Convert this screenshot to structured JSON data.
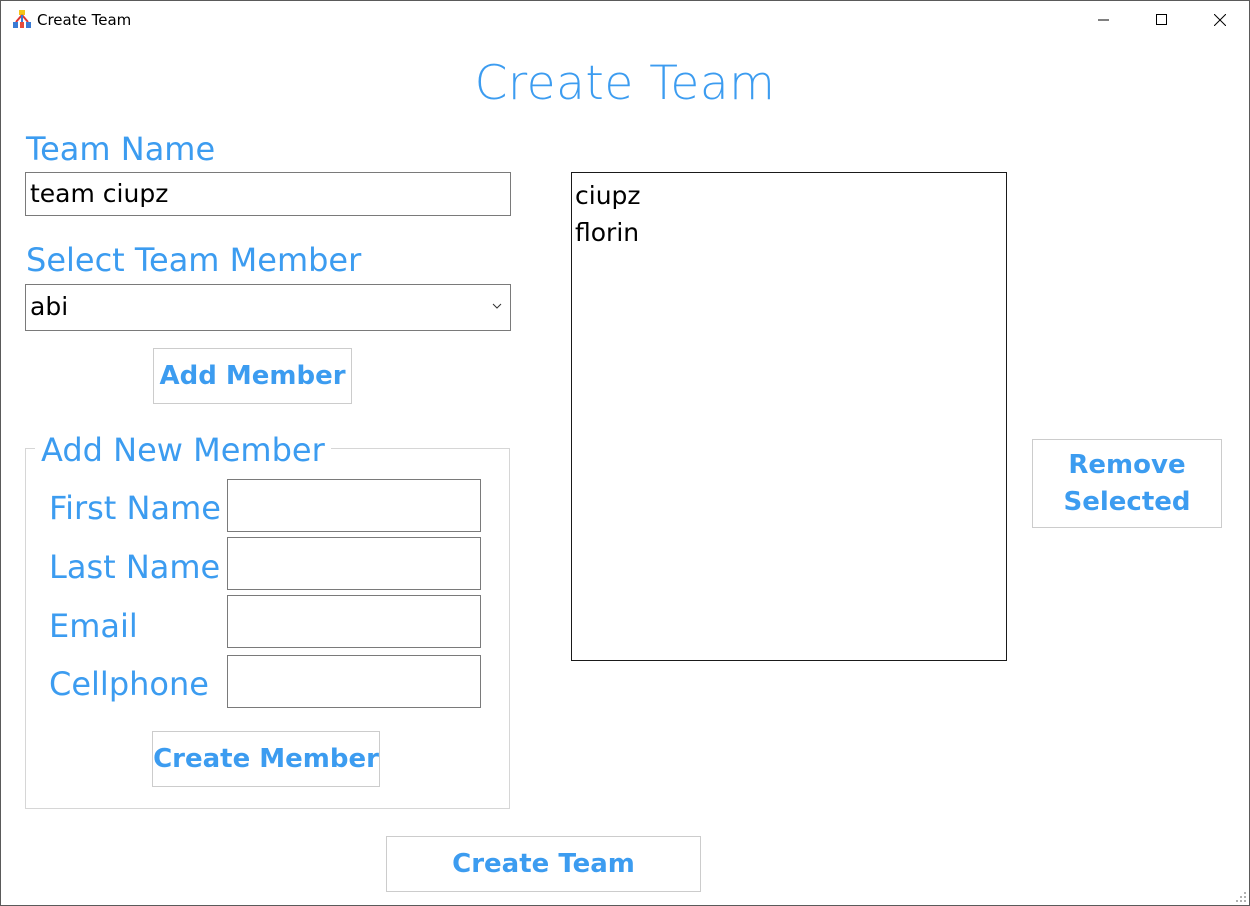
{
  "window": {
    "title": "Create Team"
  },
  "heading": "Create Team",
  "team_name": {
    "label": "Team Name",
    "value": "team ciupz"
  },
  "select_member": {
    "label": "Select Team Member",
    "selected": "abi"
  },
  "add_member_button": "Add Member",
  "new_member": {
    "legend": "Add New Member",
    "first_name_label": "First Name",
    "last_name_label": "Last Name",
    "email_label": "Email",
    "cellphone_label": "Cellphone",
    "first_name_value": "",
    "last_name_value": "",
    "email_value": "",
    "cellphone_value": "",
    "create_button": "Create Member"
  },
  "members_list": {
    "items": [
      "ciupz",
      "florin"
    ]
  },
  "remove_button": {
    "line1": "Remove",
    "line2": "Selected"
  },
  "create_team_button": "Create Team",
  "colors": {
    "accent": "#3c9cf0",
    "border": "#7a7a7a"
  }
}
